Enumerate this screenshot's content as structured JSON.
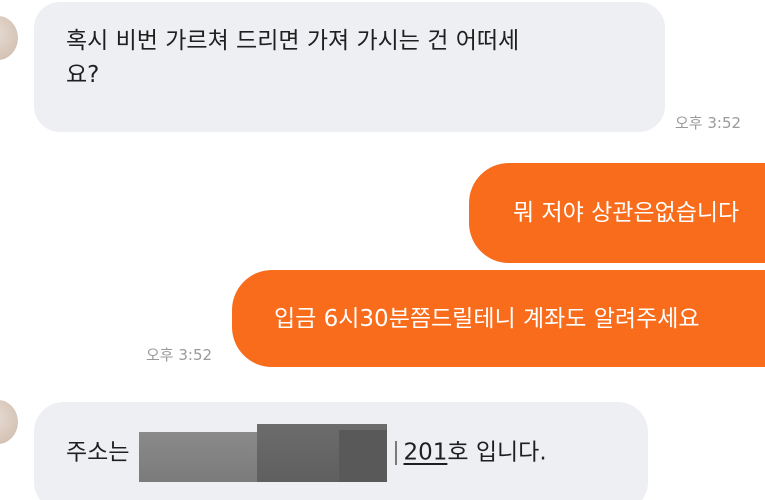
{
  "messages": {
    "m1": {
      "text_line1": "혹시 비번 가르쳐 드리면 가져 가시는 건 어떠세",
      "text_line2": "요?",
      "time": "오후 3:52"
    },
    "m2": {
      "text": "뭐 저야 상관은없습니다"
    },
    "m3": {
      "text": "입금 6시30분쯤드릴테니 계좌도 알려주세요",
      "time": "오후 3:52"
    },
    "m4": {
      "prefix": "주소는",
      "number": "201",
      "suffix": "호 입니다."
    }
  }
}
